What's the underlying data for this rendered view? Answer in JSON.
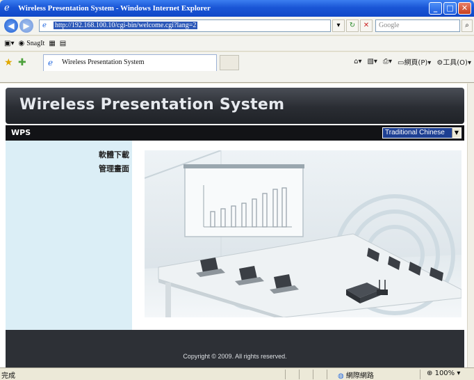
{
  "window": {
    "title": "Wireless Presentation System - Windows Internet Explorer",
    "address_url": "http://192.168.100.10/cgi-bin/welcome.cgi?lang=2",
    "search_placeholder": "Google"
  },
  "menu": {
    "snagit_label": "SnagIt"
  },
  "tab": {
    "label": "Wireless Presentation System"
  },
  "toolbar": {
    "page_label": "網頁(P)",
    "tools_label": "工具(O)"
  },
  "page": {
    "header_title": "Wireless Presentation System",
    "nav_label": "WPS",
    "language_selected": "Traditional Chinese",
    "sidebar_links": [
      "軟體下載",
      "管理畫面"
    ],
    "footer_copyright": "Copyright © 2009. All rights reserved."
  },
  "status": {
    "done_text": "完成",
    "zone_text": "網際網路",
    "zoom_text": "100%"
  }
}
